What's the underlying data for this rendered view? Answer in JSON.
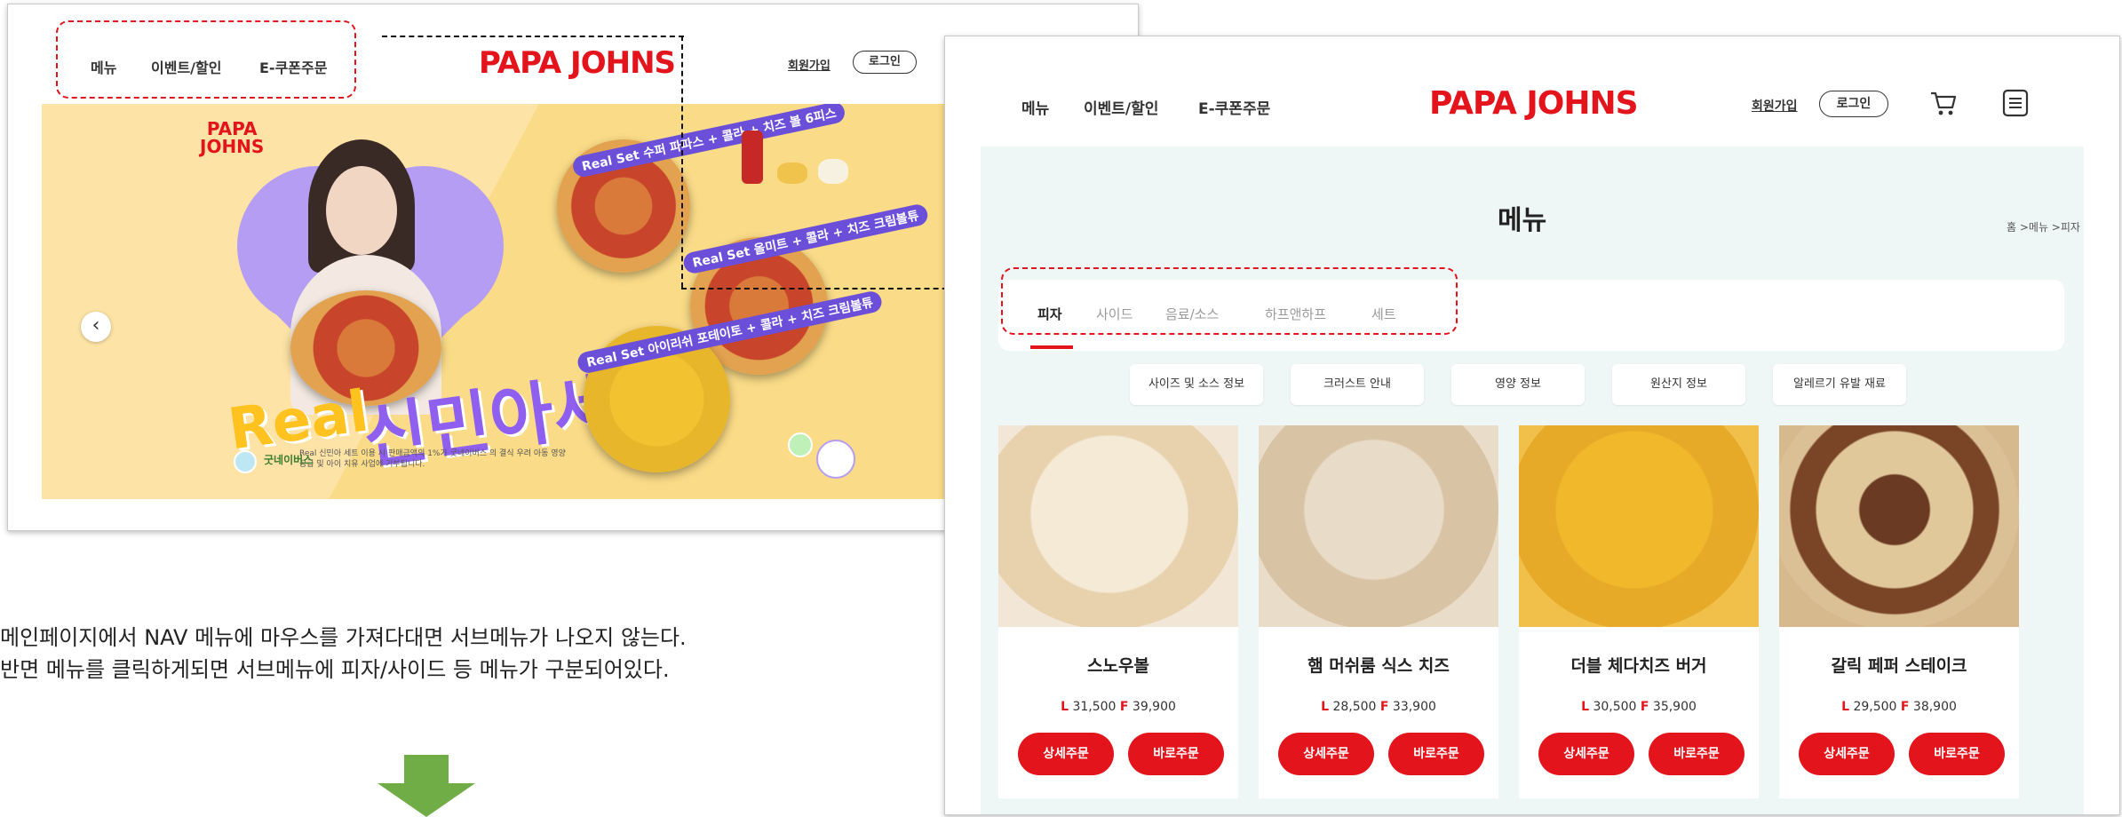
{
  "left_screenshot": {
    "nav": [
      "메뉴",
      "이벤트/할인",
      "E-쿠폰주문"
    ],
    "logo": "PAPA JOHNS",
    "signup": "회원가입",
    "login": "로그인",
    "hero": {
      "logo_line1": "PAPA",
      "logo_line2": "JOHNS",
      "real": "Real",
      "title": "신민아세트",
      "set1": "Real Set 수퍼 파파스 + 콜라 + 치즈 볼 6피스",
      "set2": "Real Set 올미트 + 콜라 + 치즈 크림볼튜",
      "set3": "Real Set 아이리쉬 포테이토 + 콜라 + 치즈 크림볼튜",
      "fine_print": "Real 신민아 세트 이용 시 판매금액의 1%가 굿네이버스 의 결식 우려 아동 영양공급 및 아이 치유 사업에 기부됩니다.",
      "partner": "굿네이버스"
    }
  },
  "right_screenshot": {
    "nav": [
      "메뉴",
      "이벤트/할인",
      "E-쿠폰주문"
    ],
    "logo": "PAPA JOHNS",
    "signup": "회원가입",
    "login": "로그인",
    "page_title": "메뉴",
    "breadcrumb": "홈 >메뉴 >피자",
    "tabs": [
      "피자",
      "사이드",
      "음료/소스",
      "하프앤하프",
      "세트"
    ],
    "info_buttons": [
      "사이즈 및 소스 정보",
      "크러스트 안내",
      "영양 정보",
      "원산지 정보",
      "알레르기 유발 재료"
    ],
    "products": [
      {
        "name": "스노우볼",
        "L": "31,500",
        "F": "39,900"
      },
      {
        "name": "햄 머쉬룸 식스 치즈",
        "L": "28,500",
        "F": "33,900"
      },
      {
        "name": "더블 체다치즈 버거",
        "L": "30,500",
        "F": "35,900"
      },
      {
        "name": "갈릭 페퍼 스테이크",
        "L": "29,500",
        "F": "38,900"
      }
    ],
    "size_l": "L",
    "size_f": "F",
    "detail_btn": "상세주문",
    "order_btn": "바로주문"
  },
  "description": {
    "line1": "메인페이지에서 NAV 메뉴에 마우스를 가져다대면 서브메뉴가 나오지 않는다.",
    "line2": "반면 메뉴를 클릭하게되면 서브메뉴에 피자/사이드 등 메뉴가 구분되어있다."
  },
  "colors": {
    "brand_red": "#e3141b",
    "annotation_red": "#e3141b",
    "arrow_green": "#70ad47",
    "hero_bg": "#fde3a5",
    "menu_bg": "#eef6f6"
  }
}
